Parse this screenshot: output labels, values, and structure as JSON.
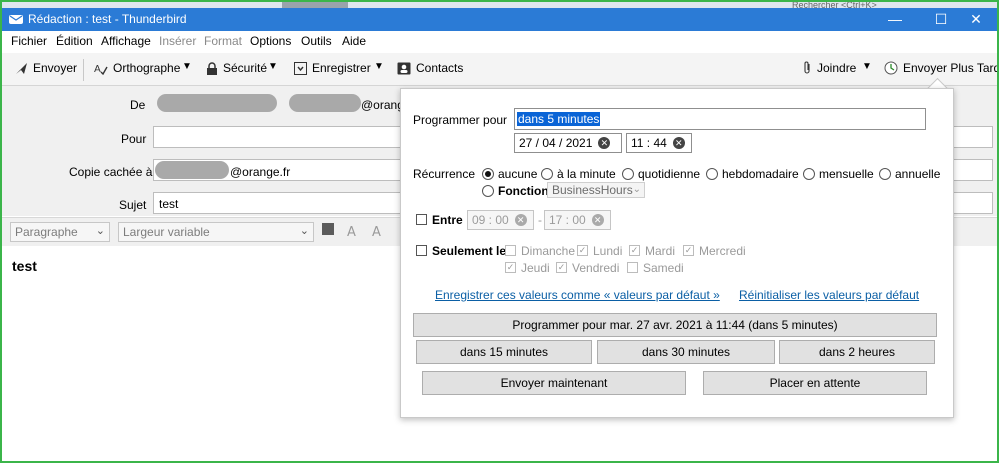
{
  "window": {
    "title": "Rédaction : test - Thunderbird",
    "minimize_glyph": "—",
    "maximize_glyph": "☐",
    "close_glyph": "✕",
    "search_hint": "Rechercher <Ctrl+K>"
  },
  "menubar": {
    "items": [
      "Fichier",
      "Édition",
      "Affichage",
      "Insérer",
      "Format",
      "Options",
      "Outils",
      "Aide"
    ]
  },
  "toolbar": {
    "send_label": "Envoyer",
    "spelling_label": "Orthographe",
    "security_label": "Sécurité",
    "save_label": "Enregistrer",
    "contacts_label": "Contacts",
    "attach_label": "Joindre",
    "send_later_label": "Envoyer Plus Tard"
  },
  "header": {
    "from_label": "De",
    "from_domain": "@orang",
    "to_label": "Pour",
    "bcc_label": "Copie cachée à",
    "bcc_domain": "@orange.fr",
    "subject_label": "Sujet",
    "subject_value": "test"
  },
  "format_bar": {
    "paragraph": "Paragraphe",
    "font": "Largeur variable"
  },
  "body_text": "test",
  "scheduler": {
    "schedule_label": "Programmer pour",
    "schedule_value": "dans 5 minutes",
    "date": "27 / 04 / 2021",
    "time": "11 : 44",
    "recurrence_label": "Récurrence",
    "recurrence_options": [
      "aucune",
      "à la minute",
      "quotidienne",
      "hebdomadaire",
      "mensuelle",
      "annuelle"
    ],
    "recurrence_selected": "aucune",
    "function_label": "Fonction",
    "function_value": "BusinessHours",
    "between_label": "Entre",
    "between_start": "09 : 00",
    "between_end": "17 : 00",
    "between_dash": "-",
    "only_label": "Seulement le",
    "days": [
      {
        "label": "Dimanche",
        "checked": false
      },
      {
        "label": "Lundi",
        "checked": true
      },
      {
        "label": "Mardi",
        "checked": true
      },
      {
        "label": "Mercredi",
        "checked": true
      },
      {
        "label": "Jeudi",
        "checked": true
      },
      {
        "label": "Vendredi",
        "checked": true
      },
      {
        "label": "Samedi",
        "checked": false
      }
    ],
    "save_defaults_link": "Enregistrer ces valeurs comme « valeurs par défaut »",
    "reset_defaults_link": "Réinitialiser les valeurs par défaut",
    "schedule_button": "Programmer pour mar. 27 avr. 2021 à 11:44 (dans 5 minutes)",
    "quick_15": "dans 15 minutes",
    "quick_30": "dans 30 minutes",
    "quick_2h": "dans 2 heures",
    "send_now_button": "Envoyer maintenant",
    "queue_button": "Placer en attente"
  }
}
